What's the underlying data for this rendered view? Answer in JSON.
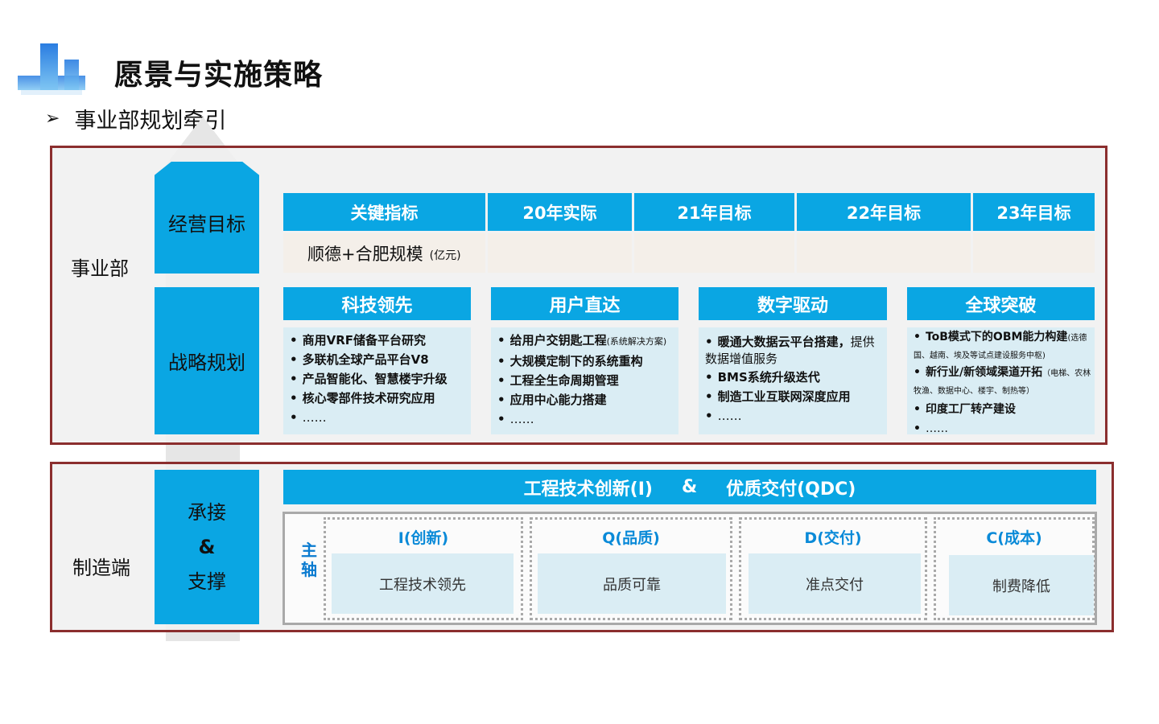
{
  "page": {
    "title": "愿景与实施策略",
    "subtitle_arrow": "➢",
    "subtitle": "事业部规划牵引"
  },
  "colors": {
    "accent_blue": "#0aa6e3",
    "frame_red": "#8b2e2e",
    "light_blue": "#daedf4",
    "beige_cell": "#f4efe9"
  },
  "bu": {
    "side_label": "事业部",
    "goal_block": "经营目标",
    "strategy_block": "战略规划",
    "kpi_table": {
      "headers": [
        "关键指标",
        "20年实际",
        "21年目标",
        "22年目标",
        "23年目标"
      ],
      "row_label": "顺德+合肥规模",
      "row_unit": "(亿元)"
    },
    "cards": [
      {
        "title": "科技领先",
        "bullets": [
          "商用VRF储备平台研究",
          "多联机全球产品平台V8",
          "产品智能化、智慧楼宇升级",
          "核心零部件技术研究应用",
          "……"
        ]
      },
      {
        "title": "用户直达",
        "b1": "给用户交钥匙工程",
        "b1_note": "(系统解决方案)",
        "bullets": [
          "大规模定制下的系统重构",
          "工程全生命周期管理",
          "应用中心能力搭建",
          "……"
        ]
      },
      {
        "title": "数字驱动",
        "b1": "暖通大数据云平台搭建，",
        "b1_rest": "提供数据增值服务",
        "bullets": [
          "BMS系统升级迭代",
          "制造工业互联网深度应用",
          "……"
        ]
      },
      {
        "title": "全球突破",
        "b1": "ToB模式下的OBM能力构建",
        "b1_note": "(选德国、越南、埃及等试点建设服务中枢)",
        "b2": "新行业/新领域渠道开拓",
        "b2_note": "（电梯、农林牧渔、数据中心、楼宇、制热等）",
        "bullets": [
          "印度工厂转产建设",
          "……"
        ]
      }
    ]
  },
  "mfg": {
    "side_label": "制造端",
    "support_block": [
      "承接",
      "&",
      "支撑"
    ],
    "banner_left": "工程技术创新(I)",
    "banner_amp": "&",
    "banner_right": "优质交付(QDC)",
    "axis_label": [
      "主",
      "轴"
    ],
    "columns": [
      {
        "head": "I(创新)",
        "body": "工程技术领先"
      },
      {
        "head": "Q(品质)",
        "body": "品质可靠"
      },
      {
        "head": "D(交付)",
        "body": "准点交付"
      },
      {
        "head": "C(成本)",
        "body": "制费降低"
      }
    ]
  }
}
